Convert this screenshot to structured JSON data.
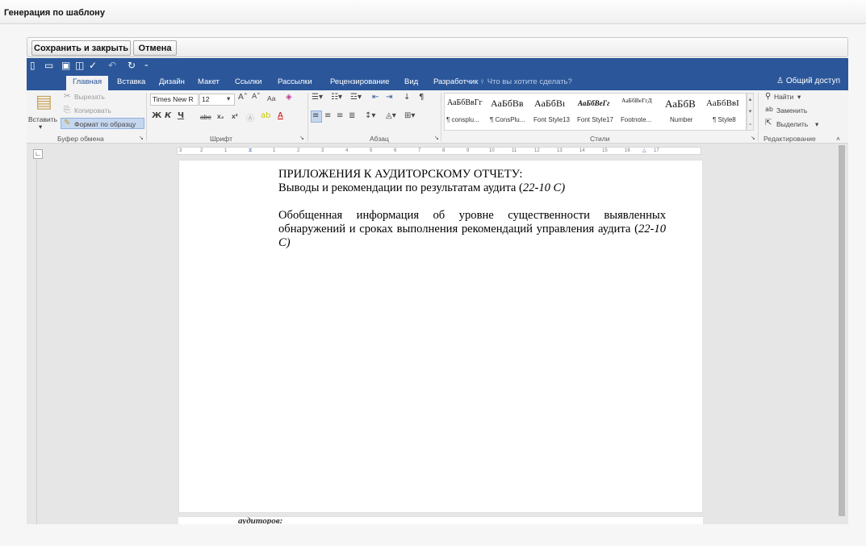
{
  "window": {
    "title": "Генерация по шаблону"
  },
  "actions": {
    "save_close": "Сохранить и закрыть",
    "cancel": "Отмена"
  },
  "quick_access": {
    "icons": [
      "new-doc-icon",
      "open-icon",
      "save-icon",
      "print-preview-icon",
      "spelling-icon",
      "undo-icon",
      "redo-icon",
      "customize-icon"
    ]
  },
  "ribbon_tabs": [
    {
      "label": "Главная",
      "active": true
    },
    {
      "label": "Вставка"
    },
    {
      "label": "Дизайн"
    },
    {
      "label": "Макет"
    },
    {
      "label": "Ссылки"
    },
    {
      "label": "Рассылки"
    },
    {
      "label": "Рецензирование"
    },
    {
      "label": "Вид"
    },
    {
      "label": "Разработчик"
    }
  ],
  "tell_me": "Что вы хотите сделать?",
  "share": "Общий доступ",
  "clipboard": {
    "paste": "Вставить",
    "cut": "Вырезать",
    "copy": "Копировать",
    "format_painter": "Формат по образцу",
    "group": "Буфер обмена"
  },
  "font": {
    "name": "Times New R",
    "size": "12",
    "case_label": "Аа",
    "bold": "Ж",
    "italic": "К",
    "underline": "Ч",
    "strike": "abc",
    "subscript": "x₂",
    "superscript": "x²",
    "group": "Шрифт"
  },
  "paragraph": {
    "group": "Абзац"
  },
  "styles": {
    "group": "Стили",
    "items": [
      {
        "sample": "АаБбВвГг",
        "name": "¶ consplu..."
      },
      {
        "sample": "АаБбВв",
        "name": "¶ ConsPlu..."
      },
      {
        "sample": "АаБбВı",
        "name": "Font Style13"
      },
      {
        "sample": "АаБбВеГг",
        "name": "Font Style17"
      },
      {
        "sample": "АаБбВеГгД",
        "name": "Footnote..."
      },
      {
        "sample": "АаБбВ",
        "name": "Number"
      },
      {
        "sample": "АаБбВвI",
        "name": "¶ Style8"
      }
    ]
  },
  "editing": {
    "find": "Найти",
    "replace": "Заменить",
    "select": "Выделить",
    "group": "Редактирование"
  },
  "ruler": {
    "marks": [
      "3",
      "2",
      "1",
      "1",
      "2",
      "3",
      "4",
      "5",
      "6",
      "7",
      "8",
      "9",
      "10",
      "11",
      "12",
      "13",
      "14",
      "15",
      "16",
      "17"
    ]
  },
  "document": {
    "heading": "ПРИЛОЖЕНИЯ К АУДИТОРСКОМУ ОТЧЕТУ:",
    "para1_main": "Выводы и рекомендации по результатам аудита (",
    "para1_ref": "22-10 С)",
    "para2_main": "Обобщенная информация об уровне существенности выявленных обнаружений и сроках выполнения рекомендаций управления аудита (",
    "para2_ref": "22-10 С)",
    "next_page_fragment": "аудиторов:"
  }
}
